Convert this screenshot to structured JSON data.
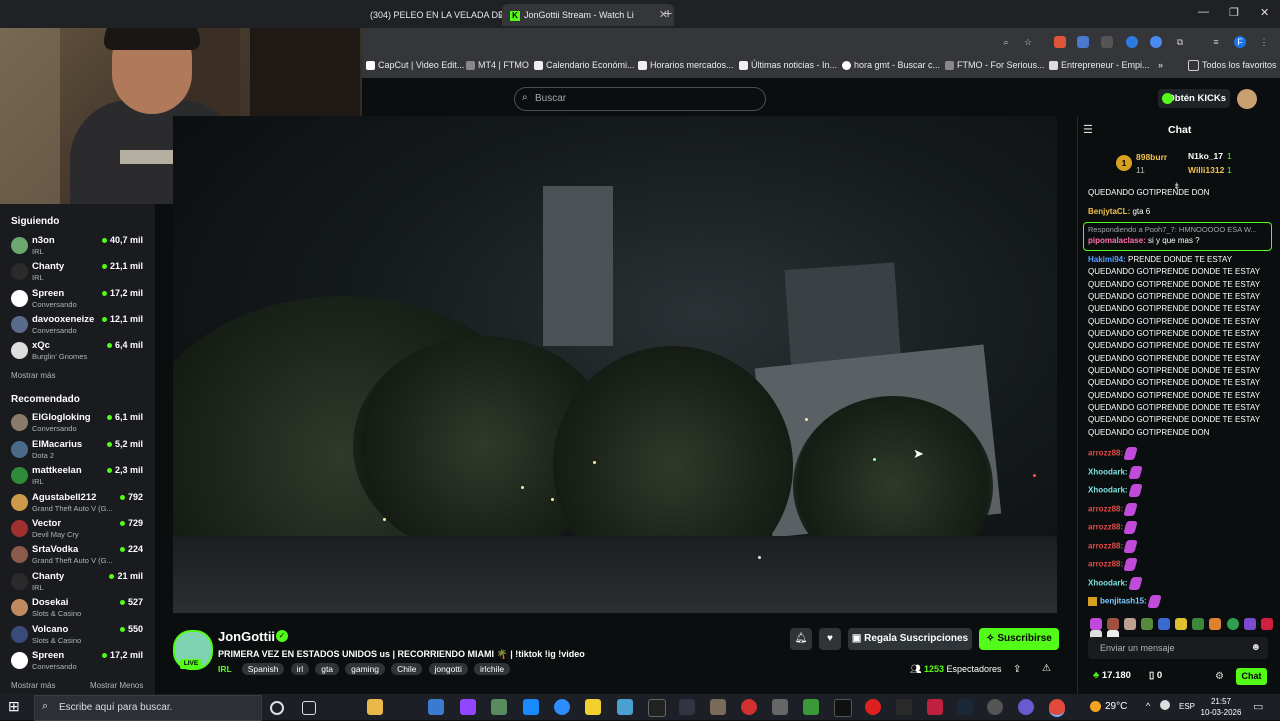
{
  "browser": {
    "tabs": [
      {
        "title": "(304) PELEO EN LA VELADA DE"
      },
      {
        "title": "JonGottii Stream - Watch Li"
      }
    ],
    "bookmarks": [
      "CapCut | Video Edit...",
      "MT4 | FTMO",
      "Calendario Económi...",
      "Horarios mercados...",
      "Últimas noticias - In...",
      "hora gmt - Buscar c...",
      "FTMO - For Serious...",
      "Entrepreneur - Empi...",
      "Todos los favoritos"
    ]
  },
  "header": {
    "search_placeholder": "Buscar",
    "get_kicks_label": "Obtén KICKs"
  },
  "sidebar": {
    "following_title": "Siguiendo",
    "following": [
      {
        "name": "n3on",
        "category": "IRL",
        "viewers": "40,7 mil",
        "color": "#6aa86f"
      },
      {
        "name": "Chanty",
        "category": "IRL",
        "viewers": "21,1 mil",
        "color": "#2b2b2b"
      },
      {
        "name": "Spreen",
        "category": "Conversando",
        "viewers": "17,2 mil",
        "color": "#ffffff"
      },
      {
        "name": "davooxeneize",
        "category": "Conversando",
        "viewers": "12,1 mil",
        "color": "#5a6b8c"
      },
      {
        "name": "xQc",
        "category": "Burglin' Gnomes",
        "viewers": "6,4 mil",
        "color": "#dddddd"
      }
    ],
    "show_more_1": "Mostrar más",
    "recommended_title": "Recomendado",
    "recommended": [
      {
        "name": "ElGlogloking",
        "category": "Conversando",
        "viewers": "6,1 mil",
        "color": "#8a7a6a"
      },
      {
        "name": "ElMacarius",
        "category": "Dota 2",
        "viewers": "5,2 mil",
        "color": "#4b6a8a"
      },
      {
        "name": "mattkeelan",
        "category": "IRL",
        "viewers": "2,3 mil",
        "color": "#2f8a3a"
      },
      {
        "name": "Agustabell212",
        "category": "Grand Theft Auto V (G...",
        "viewers": "792",
        "color": "#cc9a4a"
      },
      {
        "name": "Vector",
        "category": "Devil May Cry",
        "viewers": "729",
        "color": "#a03030"
      },
      {
        "name": "SrtaVodka",
        "category": "Grand Theft Auto V (G...",
        "viewers": "224",
        "color": "#8a5a4a"
      },
      {
        "name": "Chanty",
        "category": "IRL",
        "viewers": "21 mil",
        "color": "#2b2b2b"
      },
      {
        "name": "Dosekai",
        "category": "Slots & Casino",
        "viewers": "527",
        "color": "#c08a60"
      },
      {
        "name": "Volcano",
        "category": "Slots & Casino",
        "viewers": "550",
        "color": "#3a4a7a"
      },
      {
        "name": "Spreen",
        "category": "Conversando",
        "viewers": "17,2 mil",
        "color": "#ffffff"
      }
    ],
    "show_more_2": "Mostrar más",
    "show_less": "Mostrar Menos"
  },
  "stream": {
    "streamer": "JonGottii",
    "live": "LIVE",
    "title": "PRIMERA VEZ EN ESTADOS UNIDOS us | RECORRIENDO MIAMI 🌴 | !tiktok !ig !video",
    "category": "IRL",
    "tags": [
      "Spanish",
      "irl",
      "gta",
      "gaming",
      "Chile",
      "jongotti",
      "irlchile"
    ],
    "gift_label": "Regala Suscripciones",
    "subscribe_label": "Suscribirse",
    "viewers": "1253",
    "viewers_label": "Espectadores"
  },
  "chat": {
    "title": "Chat",
    "leaderboard": [
      {
        "rank": "1",
        "name": "898burr",
        "count": "11"
      },
      {
        "rank": "",
        "name": "N1ko_17",
        "count": "1"
      },
      {
        "rank": "",
        "name": "Willi1312",
        "count": "1"
      }
    ],
    "top_line": "QUEDANDO GOTIPRENDE DON",
    "msg_benjyta_user": "BenjytaCL:",
    "msg_benjyta_text": " gta 6",
    "reply_to": "Respondiendo a Pooh7_7: HMNOOOOO ESA W...",
    "reply_user": "pipomalaclase:",
    "reply_text": " si y que mas ?",
    "spam_user": "Hakimi94:",
    "spam_first": " PRENDE DONDE TE ESTAY",
    "spam_lines": [
      "QUEDANDO GOTIPRENDE DONDE TE ESTAY",
      "QUEDANDO GOTIPRENDE DONDE TE ESTAY",
      "QUEDANDO GOTIPRENDE DONDE TE ESTAY",
      "QUEDANDO GOTIPRENDE DONDE TE ESTAY",
      "QUEDANDO GOTIPRENDE DONDE TE ESTAY",
      "QUEDANDO GOTIPRENDE DONDE TE ESTAY",
      "QUEDANDO GOTIPRENDE DONDE TE ESTAY",
      "QUEDANDO GOTIPRENDE DONDE TE ESTAY",
      "QUEDANDO GOTIPRENDE DONDE TE ESTAY",
      "QUEDANDO GOTIPRENDE DONDE TE ESTAY",
      "QUEDANDO GOTIPRENDE DONDE TE ESTAY",
      "QUEDANDO GOTIPRENDE DONDE TE ESTAY",
      "QUEDANDO GOTIPRENDE DONDE TE ESTAY",
      "QUEDANDO GOTIPRENDE DON"
    ],
    "emote_msgs": [
      {
        "user": "arrozz88:",
        "color": "#e04a4a"
      },
      {
        "user": "Xhoodark:",
        "color": "#7ee0e0"
      },
      {
        "user": "Xhoodark:",
        "color": "#7ee0e0"
      },
      {
        "user": "arrozz88:",
        "color": "#e04a4a"
      },
      {
        "user": "arrozz88:",
        "color": "#e04a4a"
      },
      {
        "user": "arrozz88:",
        "color": "#e04a4a"
      },
      {
        "user": "arrozz88:",
        "color": "#e04a4a"
      },
      {
        "user": "Xhoodark:",
        "color": "#7ee0e0"
      },
      {
        "user": "benjitash15:",
        "color": "#7ecbff"
      }
    ],
    "input_placeholder": "Enviar un mensaje",
    "kicks_count": "17.180",
    "subs_count": "0",
    "send_label": "Chat"
  },
  "taskbar": {
    "search_placeholder": "Escribe aquí para buscar.",
    "temperature": "29°C",
    "language": "ESP",
    "time": "21:57",
    "date": "10-03-2026"
  }
}
